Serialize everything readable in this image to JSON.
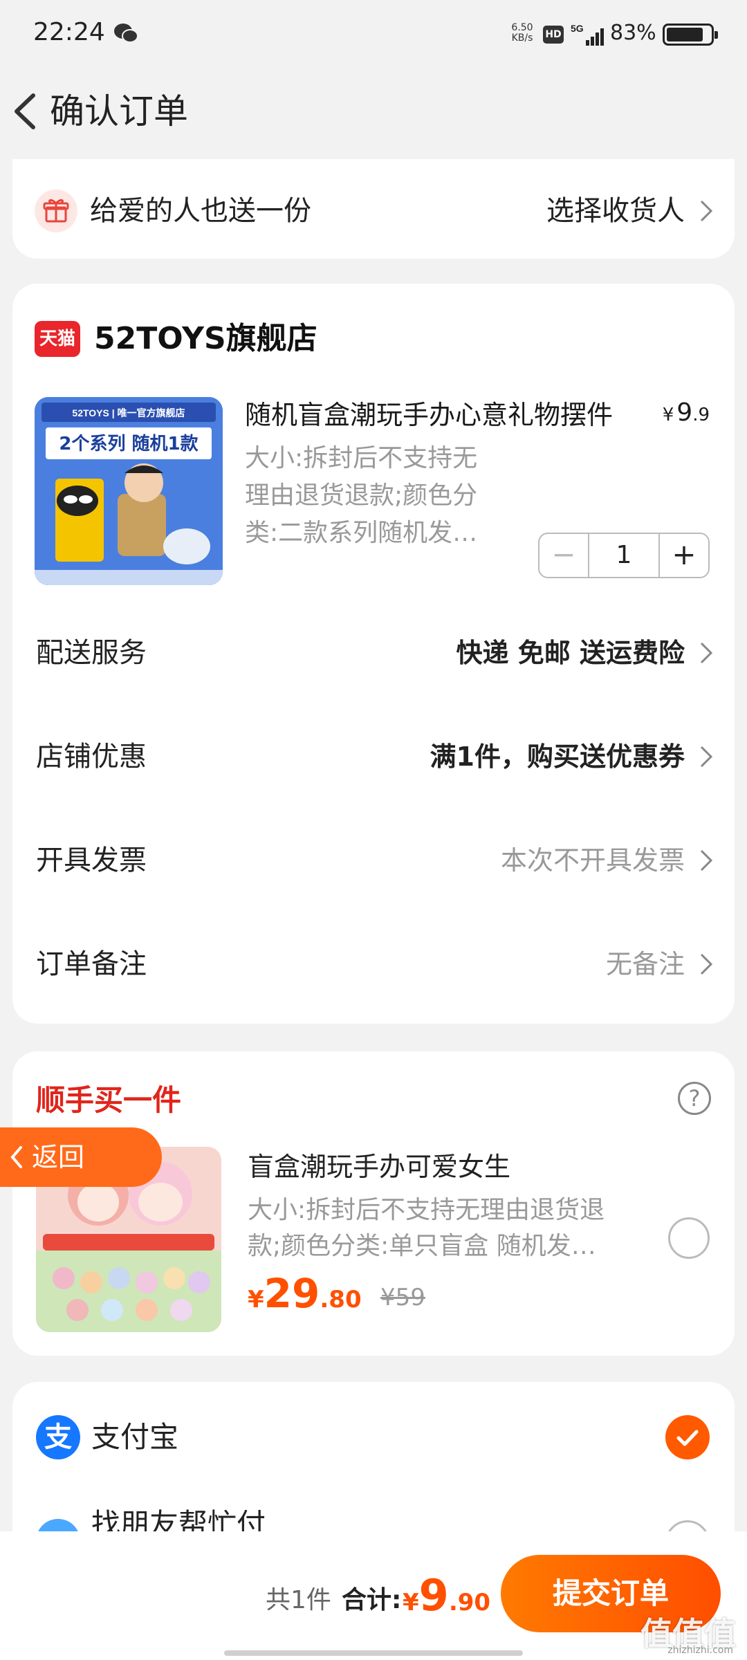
{
  "status_bar": {
    "time": "22:24",
    "net_speed_value": "6.50",
    "net_speed_unit": "KB/s",
    "hd": "HD",
    "network": "5G",
    "battery": "83%",
    "battery_level": 0.83
  },
  "header": {
    "title": "确认订单"
  },
  "gift": {
    "label": "给爱的人也送一份",
    "action": "选择收货人"
  },
  "store": {
    "badge": "天猫",
    "name": "52TOYS旗舰店"
  },
  "product": {
    "title": "随机盲盒潮玩手办心意礼物摆件",
    "price_symbol": "¥",
    "price_int": "9",
    "price_dec": ".9",
    "spec_line1": "大小:拆封后不支持无",
    "spec_line2": "理由退货退款;颜色分",
    "spec_line3": "类:二款系列随机发…",
    "quantity": "1",
    "minus": "−",
    "plus": "+",
    "image_text_top": "52TOYS | 唯一官方旗舰店",
    "image_text_main": "2个系列  随机1款"
  },
  "rows": {
    "delivery_label": "配送服务",
    "delivery_value": "快递 免邮 送运费险",
    "discount_label": "店铺优惠",
    "discount_value": "满1件，购买送优惠券",
    "invoice_label": "开具发票",
    "invoice_value": "本次不开具发票",
    "note_label": "订单备注",
    "note_value": "无备注"
  },
  "addon": {
    "title": "顺手买一件",
    "help": "?",
    "name": "盲盒潮玩手办可爱女生",
    "spec_line1": "大小:拆封后不支持无理由退货退",
    "spec_line2": "款;颜色分类:单只盲盒 随机发…",
    "price_symbol": "¥",
    "price_int": "29",
    "price_dec": ".80",
    "original_price": "¥59"
  },
  "back_float": {
    "label": "返回"
  },
  "payment": {
    "alipay_icon": "支",
    "alipay_label": "支付宝",
    "friend_label": "找朋友帮忙付"
  },
  "bottom": {
    "count": "共1件",
    "total_label": "合计:",
    "total_symbol": "¥",
    "total_int": "9",
    "total_dec": ".90",
    "submit": "提交订单"
  },
  "watermark": {
    "main": "值值值",
    "sub": "zhizhizhi.com"
  },
  "colors": {
    "accent": "#ff5000",
    "addon_title": "#e0251b",
    "tmall": "#e8262b",
    "alipay": "#1677ff"
  }
}
